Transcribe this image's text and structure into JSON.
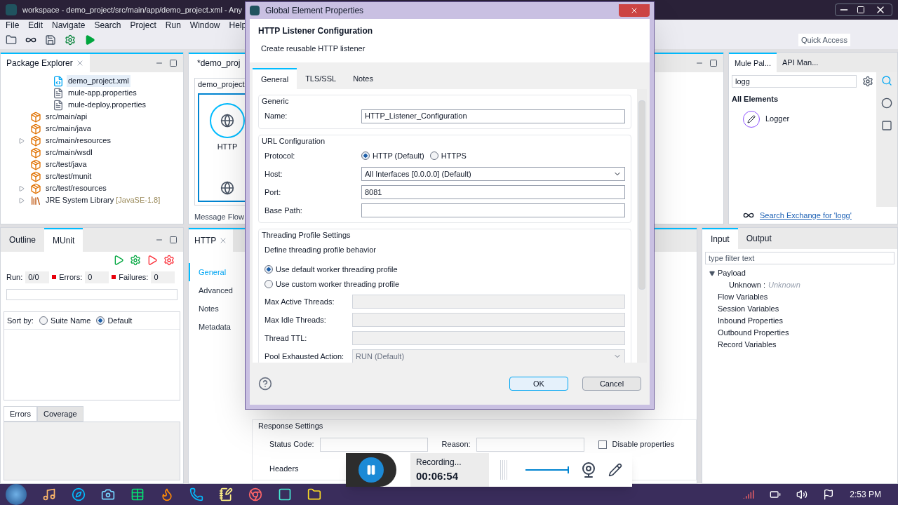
{
  "ide": {
    "title": "workspace - demo_project/src/main/app/demo_project.xml - Any",
    "menu": [
      "File",
      "Edit",
      "Navigate",
      "Search",
      "Project",
      "Run",
      "Window",
      "Help"
    ],
    "quick_access": "Quick Access"
  },
  "package_explorer": {
    "title": "Package Explorer",
    "items": [
      {
        "label": "demo_project.xml",
        "kind": "xml",
        "selected": true,
        "has_children": false
      },
      {
        "label": "mule-app.properties",
        "kind": "file",
        "selected": false,
        "has_children": false
      },
      {
        "label": "mule-deploy.properties",
        "kind": "file",
        "selected": false,
        "has_children": false
      },
      {
        "label": "src/main/api",
        "kind": "folder",
        "selected": false,
        "has_children": false
      },
      {
        "label": "src/main/java",
        "kind": "folder",
        "selected": false,
        "has_children": false
      },
      {
        "label": "src/main/resources",
        "kind": "folder",
        "selected": false,
        "has_children": true
      },
      {
        "label": "src/main/wsdl",
        "kind": "folder",
        "selected": false,
        "has_children": false
      },
      {
        "label": "src/test/java",
        "kind": "folder",
        "selected": false,
        "has_children": false
      },
      {
        "label": "src/test/munit",
        "kind": "folder",
        "selected": false,
        "has_children": false
      },
      {
        "label": "src/test/resources",
        "kind": "folder",
        "selected": false,
        "has_children": true
      },
      {
        "label": "JRE System Library",
        "suffix": "[JavaSE-1.8]",
        "kind": "library",
        "selected": false,
        "has_children": true
      }
    ]
  },
  "editor": {
    "tab": "*demo_proj",
    "canvas_tab": "demo_project",
    "node": "HTTP",
    "bottom_tab": "Message Flow"
  },
  "munit": {
    "tabs": [
      {
        "label": "Outline",
        "selected": false
      },
      {
        "label": "MUnit",
        "selected": true
      }
    ],
    "counters": [
      {
        "label": "Run:",
        "value": "0/0",
        "kind": "plain"
      },
      {
        "label": "Errors:",
        "value": "0",
        "kind": "flag"
      },
      {
        "label": "Failures:",
        "value": "0",
        "kind": "flag"
      }
    ],
    "progress": {
      "level": 0.0
    },
    "sort_label": "Sort by:",
    "sort_options": [
      {
        "label": "Suite Name",
        "selected": false
      },
      {
        "label": "Default",
        "selected": true
      }
    ],
    "bottom_tabs": [
      {
        "label": "Errors",
        "selected": true
      },
      {
        "label": "Coverage",
        "selected": false
      }
    ]
  },
  "properties": {
    "tab": "HTTP",
    "nav": [
      {
        "label": "General",
        "selected": true
      },
      {
        "label": "Advanced",
        "selected": false
      },
      {
        "label": "Notes",
        "selected": false
      },
      {
        "label": "Metadata",
        "selected": false
      }
    ],
    "response_title": "Response Settings",
    "status_label": "Status Code:",
    "reason_label": "Reason:",
    "disable": {
      "label": "Disable properties",
      "checked": false
    },
    "headers": "Headers"
  },
  "palette": {
    "tabs": [
      {
        "label": "Mule Pal...",
        "selected": true
      },
      {
        "label": "API Man...",
        "selected": false
      }
    ],
    "search": "logg",
    "group": "All Elements",
    "items": [
      "Logger"
    ],
    "exchange_link": "Search Exchange for 'logg'"
  },
  "metadata": {
    "tabs": [
      {
        "label": "Input",
        "selected": true
      },
      {
        "label": "Output",
        "selected": false
      }
    ],
    "filter_placeholder": "type filter text",
    "tree": [
      {
        "label": "Payload",
        "expanded": true,
        "children": [
          {
            "label": "Unknown",
            "separator": ":",
            "type": "Unknown"
          }
        ]
      },
      {
        "label": "Flow Variables"
      },
      {
        "label": "Session Variables"
      },
      {
        "label": "Inbound Properties"
      },
      {
        "label": "Outbound Properties"
      },
      {
        "label": "Record Variables"
      }
    ]
  },
  "dialog": {
    "title": "Global Element Properties",
    "heading": "HTTP Listener Configuration",
    "subtitle": "Create reusable HTTP listener",
    "tabs": [
      {
        "label": "General",
        "selected": true
      },
      {
        "label": "TLS/SSL",
        "selected": false
      },
      {
        "label": "Notes",
        "selected": false
      }
    ],
    "sections": [
      {
        "title": "Generic",
        "fields": [
          {
            "label": "Name:",
            "kind": "text",
            "value": "HTTP_Listener_Configuration",
            "disabled": false
          }
        ]
      },
      {
        "title": "URL Configuration",
        "fields": [
          {
            "label": "Protocol:",
            "kind": "radio",
            "options": [
              {
                "label": "HTTP (Default)",
                "selected": true
              },
              {
                "label": "HTTPS",
                "selected": false
              }
            ],
            "disabled": false
          },
          {
            "label": "Host:",
            "kind": "select",
            "value": "All Interfaces [0.0.0.0] (Default)",
            "disabled": false
          },
          {
            "label": "Port:",
            "kind": "text",
            "value": "8081",
            "disabled": false
          },
          {
            "label": "Base Path:",
            "kind": "text",
            "disabled": false
          }
        ]
      },
      {
        "title": "Threading Profile Settings",
        "description": "Define threading profile behavior",
        "options": [
          {
            "label": "Use default worker threading profile",
            "selected": true
          },
          {
            "label": "Use custom worker threading profile",
            "selected": false
          }
        ],
        "fields": [
          {
            "label": "Max Active Threads:",
            "kind": "text",
            "disabled": true
          },
          {
            "label": "Max Idle Threads:",
            "kind": "text",
            "disabled": true
          },
          {
            "label": "Thread TTL:",
            "kind": "text",
            "disabled": true
          },
          {
            "label": "Pool Exhausted Action:",
            "kind": "select",
            "value": "RUN (Default)",
            "disabled": true
          }
        ]
      }
    ],
    "buttons": [
      {
        "label": "OK",
        "default": true
      },
      {
        "label": "Cancel",
        "default": false
      }
    ]
  },
  "recorder": {
    "status": "Recording...",
    "time": "00:06:54",
    "level": 1.0
  },
  "taskbar": {
    "time": "2:53 PM"
  }
}
